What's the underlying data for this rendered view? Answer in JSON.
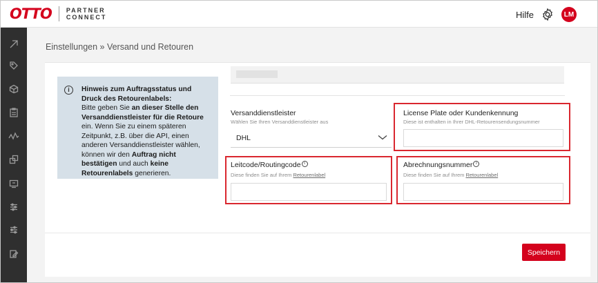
{
  "header": {
    "logo_brand": "OTTO",
    "logo_line1": "PARTNER",
    "logo_line2": "CONNECT",
    "help_label": "Hilfe",
    "avatar_initials": "LM"
  },
  "colors": {
    "brand_red": "#d4021d",
    "highlight_red": "#d9262e",
    "sidebar": "#2f2f2f",
    "hint_bg": "#d6e0e8"
  },
  "sidebar": {
    "icons": [
      "collapse-icon",
      "tag-icon",
      "package-icon",
      "clipboard-icon",
      "analytics-icon",
      "catalog-icon",
      "shop-icon",
      "settings-sliders-icon",
      "filter-sliders-icon",
      "document-edit-icon"
    ]
  },
  "breadcrumb": {
    "text": "Einstellungen » Versand und Retouren"
  },
  "hint": {
    "icon": "info-icon",
    "title": "Hinweis zum Auftragsstatus und Druck des Retourenlabels:",
    "t1": "Bitte geben Sie ",
    "b1": "an dieser Stelle den Versanddienstleister für die Retoure",
    "t2": " ein. Wenn Sie zu einem späteren Zeitpunkt, z.B. über die API, einen anderen Versanddienstleister wählen, können wir den ",
    "b2": "Auftrag nicht bestätigen",
    "t3": " und auch ",
    "b3": "keine Retourenlabels",
    "t4": " generieren."
  },
  "form": {
    "carrier": {
      "label": "Versanddienstleister",
      "help": "Wählen Sie Ihren Versanddienstleister aus",
      "value": "DHL"
    },
    "license_plate": {
      "label": "License Plate oder Kundenkennung",
      "help": "Diese ist enthalten in Ihrer DHL-Retourensendungsnummer",
      "value": ""
    },
    "leitcode": {
      "label": "Leitcode/Routingcode",
      "help_prefix": "Diese finden Sie auf Ihrem ",
      "help_link": "Retourenlabel",
      "value": ""
    },
    "abrechnung": {
      "label": "Abrechnungsnummer",
      "help_prefix": "Diese finden Sie auf Ihrem ",
      "help_link": "Retourenlabel",
      "value": ""
    }
  },
  "actions": {
    "save_label": "Speichern"
  }
}
